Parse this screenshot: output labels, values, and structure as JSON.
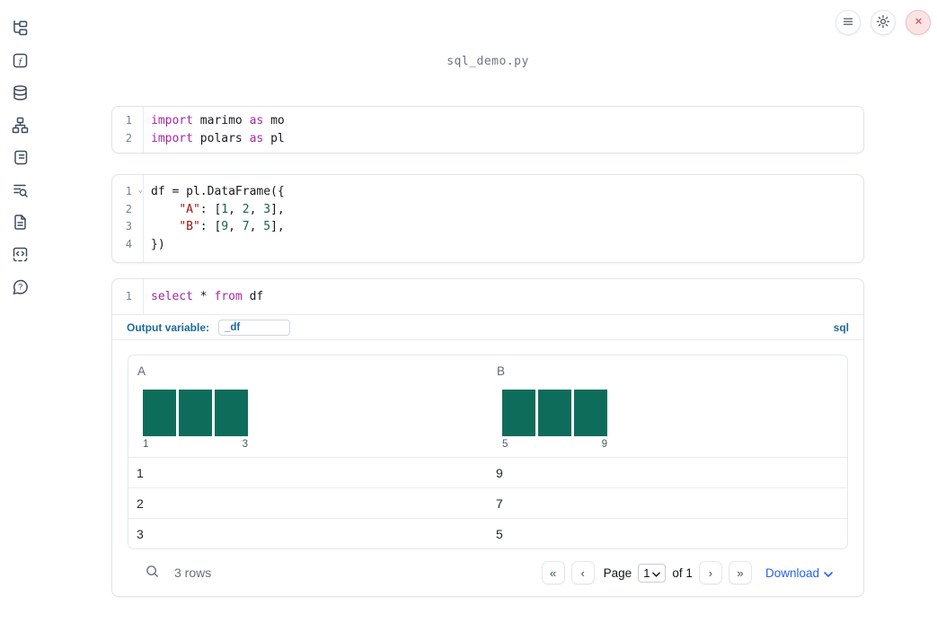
{
  "app": {
    "title": "sql_demo.py"
  },
  "header": {
    "buttons": [
      "hamburger-icon",
      "gear-icon",
      "close-icon"
    ]
  },
  "sidebar": {
    "icons": [
      "folder-tree-icon",
      "function-square-icon",
      "database-icon",
      "network-icon",
      "scroll-text-icon",
      "text-search-icon",
      "file-text-icon",
      "code-square-icon",
      "help-bubble-icon"
    ]
  },
  "colors": {
    "keyword": "#a626a4",
    "string": "#a11111",
    "number": "#116644",
    "accent_blue": "#1b6a9b",
    "link_blue": "#2563eb",
    "histogram_bar": "#0e6d5a",
    "close_red": "#c65a60"
  },
  "cells": [
    {
      "type": "code",
      "lines": [
        {
          "number": "1",
          "tokens": [
            {
              "t": "import",
              "c": "kw"
            },
            {
              "t": " marimo ",
              "c": "tx"
            },
            {
              "t": "as",
              "c": "kw"
            },
            {
              "t": " mo",
              "c": "tx"
            }
          ]
        },
        {
          "number": "2",
          "tokens": [
            {
              "t": "import",
              "c": "kw"
            },
            {
              "t": " polars ",
              "c": "tx"
            },
            {
              "t": "as",
              "c": "kw"
            },
            {
              "t": " pl",
              "c": "tx"
            }
          ]
        }
      ]
    },
    {
      "type": "code",
      "lines": [
        {
          "number": "1",
          "fold": true,
          "tokens": [
            {
              "t": "df = pl.DataFrame({",
              "c": "tx"
            }
          ]
        },
        {
          "number": "2",
          "tokens": [
            {
              "t": "    ",
              "c": "tx"
            },
            {
              "t": "\"A\"",
              "c": "str"
            },
            {
              "t": ": [",
              "c": "tx"
            },
            {
              "t": "1",
              "c": "num"
            },
            {
              "t": ", ",
              "c": "tx"
            },
            {
              "t": "2",
              "c": "num"
            },
            {
              "t": ", ",
              "c": "tx"
            },
            {
              "t": "3",
              "c": "num"
            },
            {
              "t": "],",
              "c": "tx"
            }
          ]
        },
        {
          "number": "3",
          "tokens": [
            {
              "t": "    ",
              "c": "tx"
            },
            {
              "t": "\"B\"",
              "c": "str"
            },
            {
              "t": ": [",
              "c": "tx"
            },
            {
              "t": "9",
              "c": "num"
            },
            {
              "t": ", ",
              "c": "tx"
            },
            {
              "t": "7",
              "c": "num"
            },
            {
              "t": ", ",
              "c": "tx"
            },
            {
              "t": "5",
              "c": "num"
            },
            {
              "t": "],",
              "c": "tx"
            }
          ]
        },
        {
          "number": "4",
          "tokens": [
            {
              "t": "})",
              "c": "tx"
            }
          ]
        }
      ]
    },
    {
      "type": "sql",
      "lines": [
        {
          "number": "1",
          "tokens": [
            {
              "t": "select",
              "c": "kw"
            },
            {
              "t": " * ",
              "c": "tx"
            },
            {
              "t": "from",
              "c": "kw"
            },
            {
              "t": " df",
              "c": "tx"
            }
          ]
        }
      ],
      "output_variable_label": "Output variable:",
      "output_variable_value": "_df",
      "language_badge": "sql"
    }
  ],
  "table": {
    "bar_color": "#0e6d5a",
    "columns": [
      {
        "name": "A",
        "bars": [
          1,
          1,
          1
        ],
        "min_label": "1",
        "max_label": "3"
      },
      {
        "name": "B",
        "bars": [
          1,
          1,
          1
        ],
        "min_label": "5",
        "max_label": "9"
      }
    ],
    "rows": [
      [
        "1",
        "9"
      ],
      [
        "2",
        "7"
      ],
      [
        "3",
        "5"
      ]
    ],
    "footer": {
      "row_count": "3 rows",
      "pagination": {
        "first_label": "«",
        "prev_label": "‹",
        "page_label": "Page",
        "page_value": "1",
        "of_label": "of 1",
        "next_label": "›",
        "last_label": "»"
      },
      "download_label": "Download"
    }
  }
}
